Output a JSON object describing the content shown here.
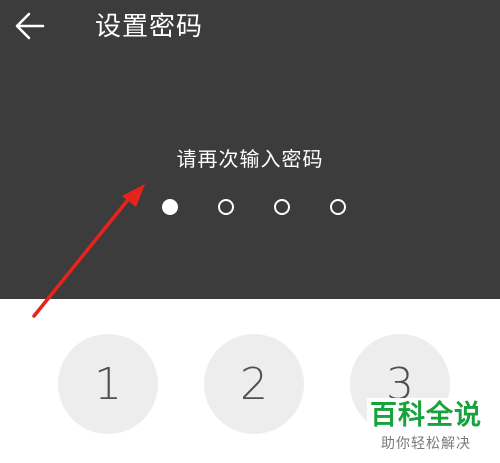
{
  "header": {
    "back_icon": "arrow-left-icon",
    "title": "设置密码"
  },
  "pin_entry": {
    "prompt": "请再次输入密码",
    "length": 4,
    "filled": 1
  },
  "keypad": {
    "keys": [
      "1",
      "2",
      "3"
    ]
  },
  "annotation": {
    "arrow_color": "#e8231c"
  },
  "watermark": {
    "title": "百科全说",
    "subtitle": "助你轻松解决"
  },
  "colors": {
    "panel_bg": "#3c3c3d",
    "key_bg": "#ecedec",
    "watermark_green": "#17a23c"
  }
}
